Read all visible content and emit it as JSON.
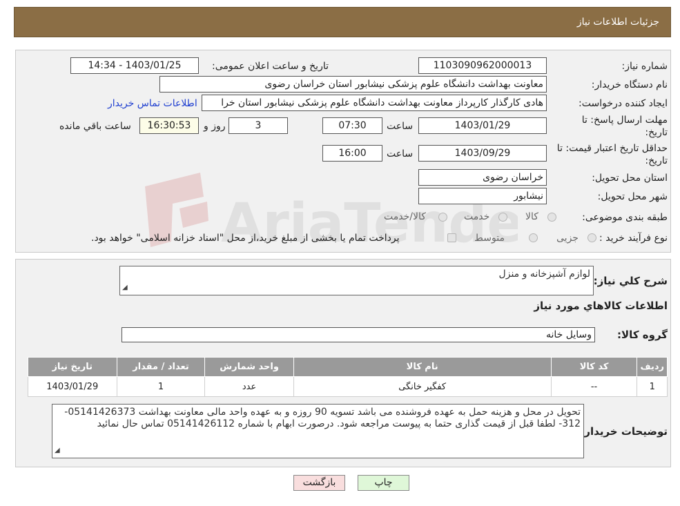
{
  "header": {
    "title": "جزئیات اطلاعات نیاز"
  },
  "form": {
    "need_number": {
      "label": "شماره نیاز:",
      "value": "1103090962000013"
    },
    "announce_datetime": {
      "label": "تاریخ و ساعت اعلان عمومی:",
      "value": "1403/01/25 - 14:34"
    },
    "buyer_org": {
      "label": "نام دستگاه خریدار:",
      "value": "معاونت بهداشت دانشگاه علوم پزشکی نیشابور استان خراسان رضوی"
    },
    "requester": {
      "label": "ایجاد کننده درخواست:",
      "value": "هادی کارگذار کارپرداز معاونت بهداشت دانشگاه علوم پزشکی نیشابور استان خرا"
    },
    "contact_link": "اطلاعات تماس خریدار",
    "reply_deadline": {
      "label_line1": "مهلت ارسال پاسخ: تا",
      "label_line2": "تاریخ:",
      "date": "1403/01/29",
      "time_label": "ساعت",
      "time": "07:30",
      "days": "3",
      "days_label": "روز و",
      "remaining_time": "16:30:53",
      "remaining_label": "ساعت باقي مانده"
    },
    "price_validity": {
      "label_line1": "حداقل تاریخ اعتبار قیمت: تا",
      "label_line2": "تاریخ:",
      "date": "1403/09/29",
      "time_label": "ساعت",
      "time": "16:00"
    },
    "delivery_province": {
      "label": "استان محل تحویل:",
      "value": "خراسان رضوی"
    },
    "delivery_city": {
      "label": "شهر محل تحویل:",
      "value": "نیشابور"
    },
    "category": {
      "label": "طبقه بندی موضوعی:",
      "options": [
        "کالا",
        "خدمت",
        "کالا/خدمت"
      ]
    },
    "purchase_type": {
      "label": "نوع فرآیند خرید :",
      "options": [
        "جزیی",
        "متوسط"
      ],
      "note": "پرداخت تمام یا بخشی از مبلغ خرید،از محل \"اسناد خزانه اسلامی\" خواهد بود."
    }
  },
  "details": {
    "summary_label": "شرح کلي نياز:",
    "summary_value": "لوازم آشپزخانه و منزل",
    "goods_info_title": "اطلاعات کالاهاي مورد نياز",
    "goods_group_label": "گروه کالا:",
    "goods_group_value": "وسایل خانه",
    "table": {
      "headers": [
        "رديف",
        "کد کالا",
        "نام کالا",
        "واحد شمارش",
        "تعداد / مقدار",
        "تاریخ نیاز"
      ],
      "rows": [
        [
          "1",
          "--",
          "کفگیر خانگی",
          "عدد",
          "1",
          "1403/01/29"
        ]
      ]
    },
    "buyer_notes_label": "توضیحات خریدار:",
    "buyer_notes_value": "تحویل در محل و هزینه حمل به عهده فروشنده می باشد تسویه 90 روزه و به عهده واحد مالی معاونت بهداشت 05141426373-312- لطفا قبل از قیمت گذاری حتما به پیوست مراجعه شود. درصورت ابهام با شماره 05141426112 تماس حال نمائید"
  },
  "buttons": {
    "print": "چاپ",
    "back": "بازگشت"
  },
  "colors": {
    "header_bg": "#8b6e45",
    "table_header_bg": "#9a9a9a",
    "link": "#1f3fd0",
    "back_button_bg": "#f9dede",
    "print_button_bg": "#dff7d8"
  }
}
